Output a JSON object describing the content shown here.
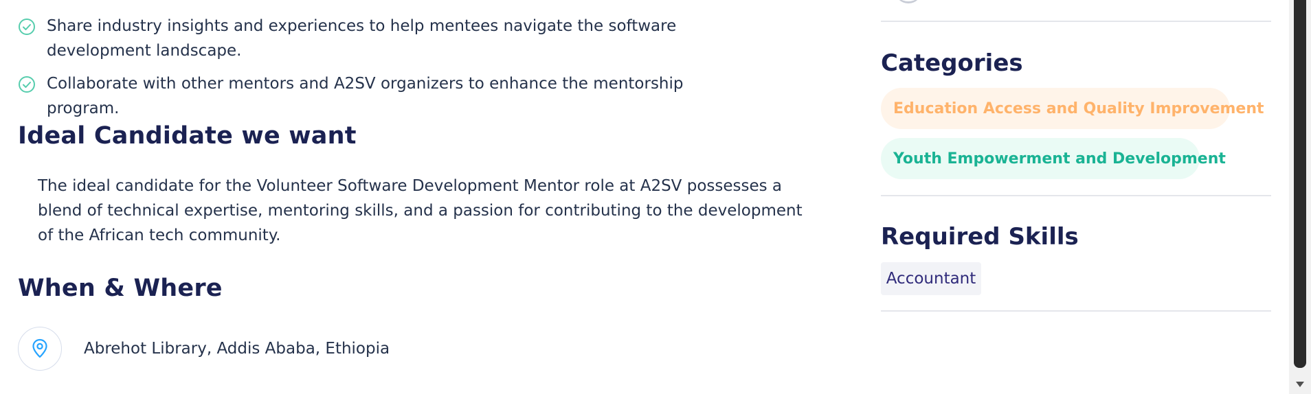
{
  "responsibilities": {
    "items": [
      {
        "text": "Share industry insights and experiences to help mentees navigate the software development landscape."
      },
      {
        "text": "Collaborate with other mentors and A2SV organizers to enhance the mentorship program."
      }
    ],
    "check_icon": "check-circle-icon"
  },
  "ideal_candidate": {
    "title": "Ideal Candidate we want",
    "text": "The ideal candidate for the Volunteer Software Development Mentor role at A2SV possesses a blend of technical expertise, mentoring skills, and a passion for contributing to the development of the African tech community."
  },
  "when_where": {
    "title": "When & Where",
    "location_icon": "location-pin-icon",
    "location": "Abrehot Library, Addis Ababa, Ethiopia"
  },
  "sidebar": {
    "categories_title": "Categories",
    "categories": [
      {
        "label": "Education Access and Quality Improvement",
        "color": "#FFB36B",
        "bg": "#FFF4E9"
      },
      {
        "label": "Youth Empowerment and Development",
        "color": "#1AB394",
        "bg": "#EAFBF5"
      }
    ],
    "skills_title": "Required Skills",
    "skills": [
      {
        "label": "Accountant"
      }
    ]
  },
  "colors": {
    "heading": "#1B2252",
    "body_text": "#25324B",
    "check_green": "#56CDAD",
    "location_blue": "#26A4FF",
    "divider": "#E4E6EB"
  }
}
